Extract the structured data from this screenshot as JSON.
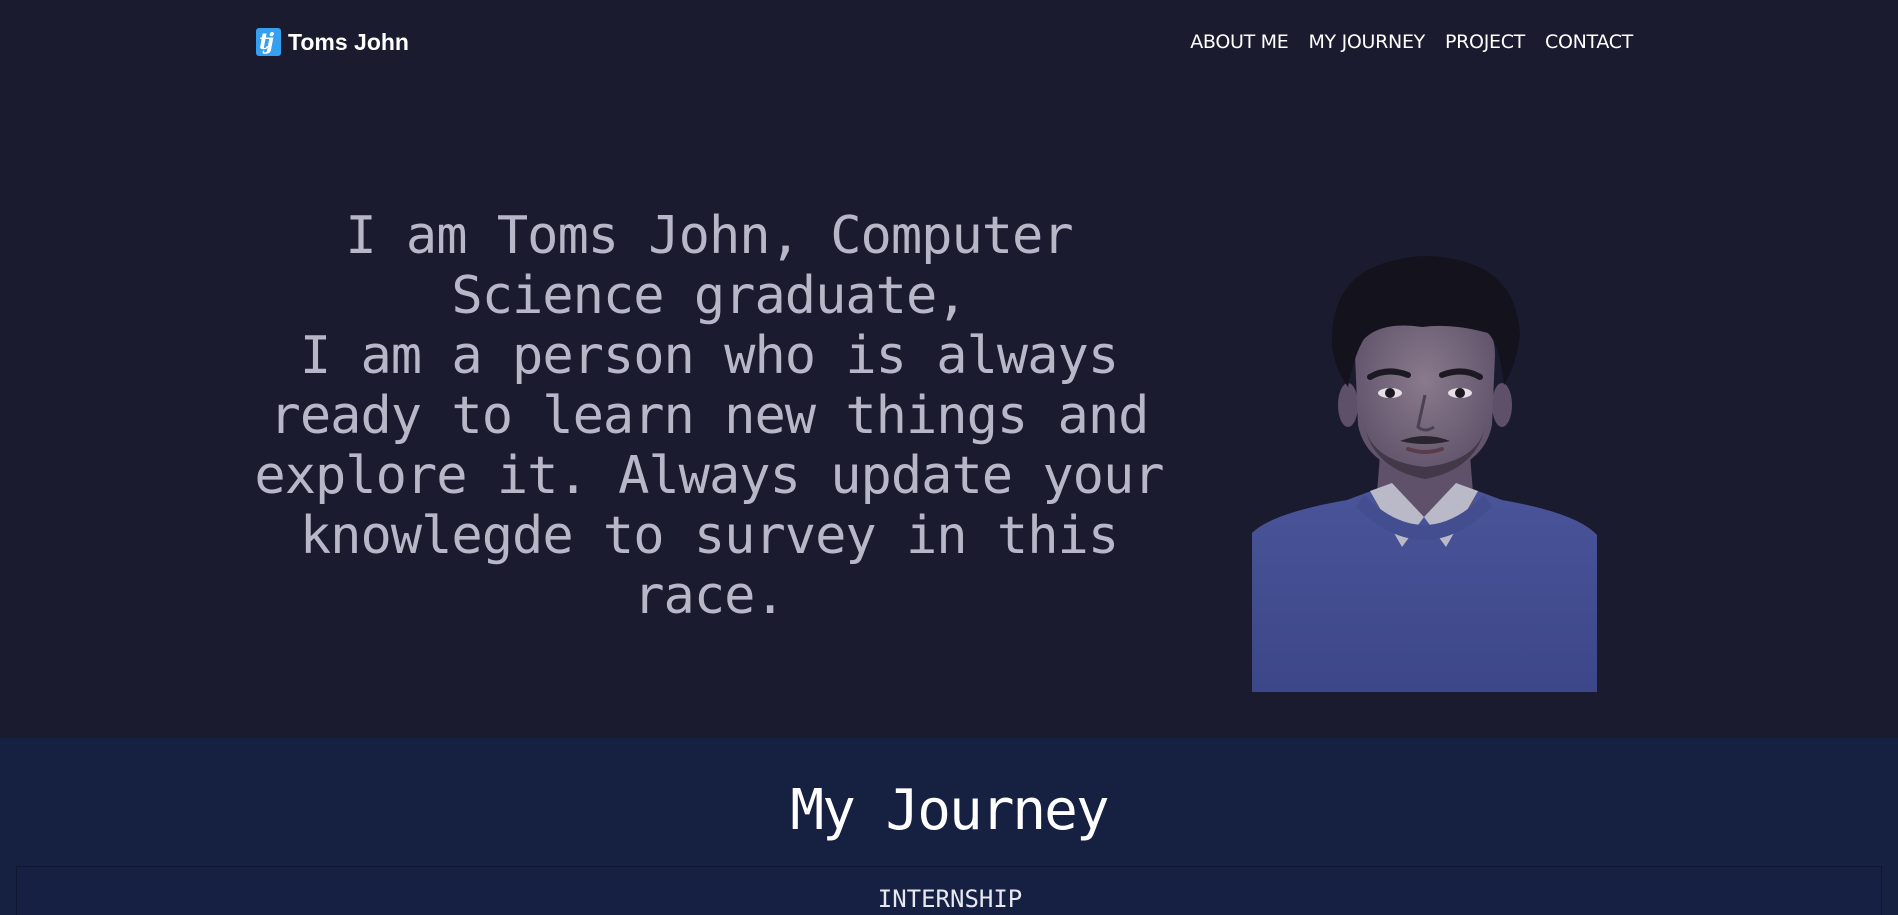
{
  "brand": {
    "logo_text": "tj",
    "name": "Toms John"
  },
  "nav": {
    "items": [
      {
        "label": "ABOUT ME"
      },
      {
        "label": "MY JOURNEY"
      },
      {
        "label": "PROJECT"
      },
      {
        "label": "CONTACT"
      }
    ]
  },
  "hero": {
    "line1": "I am Toms John, Computer Science graduate,",
    "line2": "I am a person who is always ready to learn new things and explore it. Always update your knowlegde to survey in this race."
  },
  "journey": {
    "title": "My Journey",
    "card_label": "INTERNSHIP"
  },
  "colors": {
    "page_bg": "#1b1b2f",
    "journey_bg": "#162040",
    "logo_accent": "#35a0f0",
    "hero_text": "#b7b7c8"
  }
}
